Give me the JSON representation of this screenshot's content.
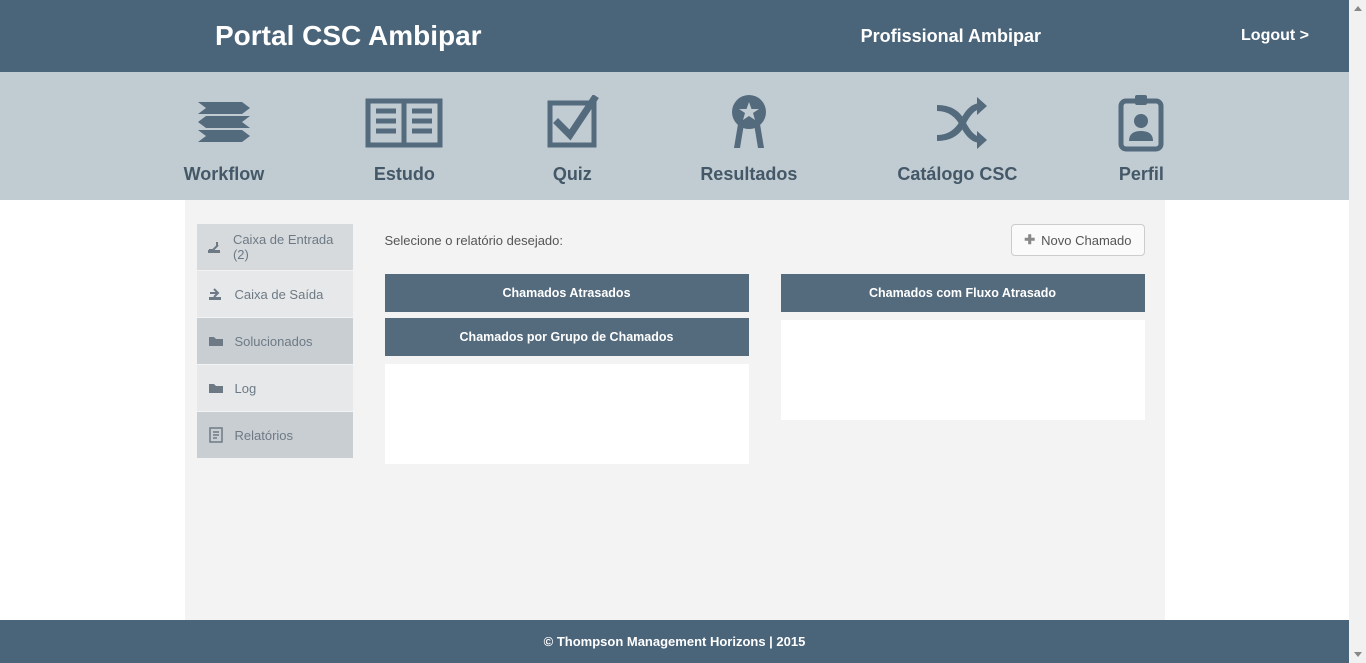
{
  "header": {
    "title": "Portal CSC Ambipar",
    "user": "Profissional Ambipar",
    "logout": "Logout >"
  },
  "topnav": {
    "items": [
      {
        "label": "Workflow"
      },
      {
        "label": "Estudo"
      },
      {
        "label": "Quiz"
      },
      {
        "label": "Resultados"
      },
      {
        "label": "Catálogo CSC"
      },
      {
        "label": "Perfil"
      }
    ]
  },
  "sidebar": {
    "items": [
      {
        "label": "Caixa de Entrada (2)"
      },
      {
        "label": "Caixa de Saída"
      },
      {
        "label": "Solucionados"
      },
      {
        "label": "Log"
      },
      {
        "label": "Relatórios"
      }
    ]
  },
  "main": {
    "instruction": "Selecione o relatório desejado:",
    "new_button": "Novo Chamado",
    "reports": {
      "left": [
        {
          "label": "Chamados Atrasados"
        },
        {
          "label": "Chamados por Grupo de Chamados"
        }
      ],
      "right": [
        {
          "label": "Chamados com Fluxo Atrasado"
        }
      ]
    }
  },
  "footer": {
    "text": "© Thompson Management Horizons | 2015"
  }
}
